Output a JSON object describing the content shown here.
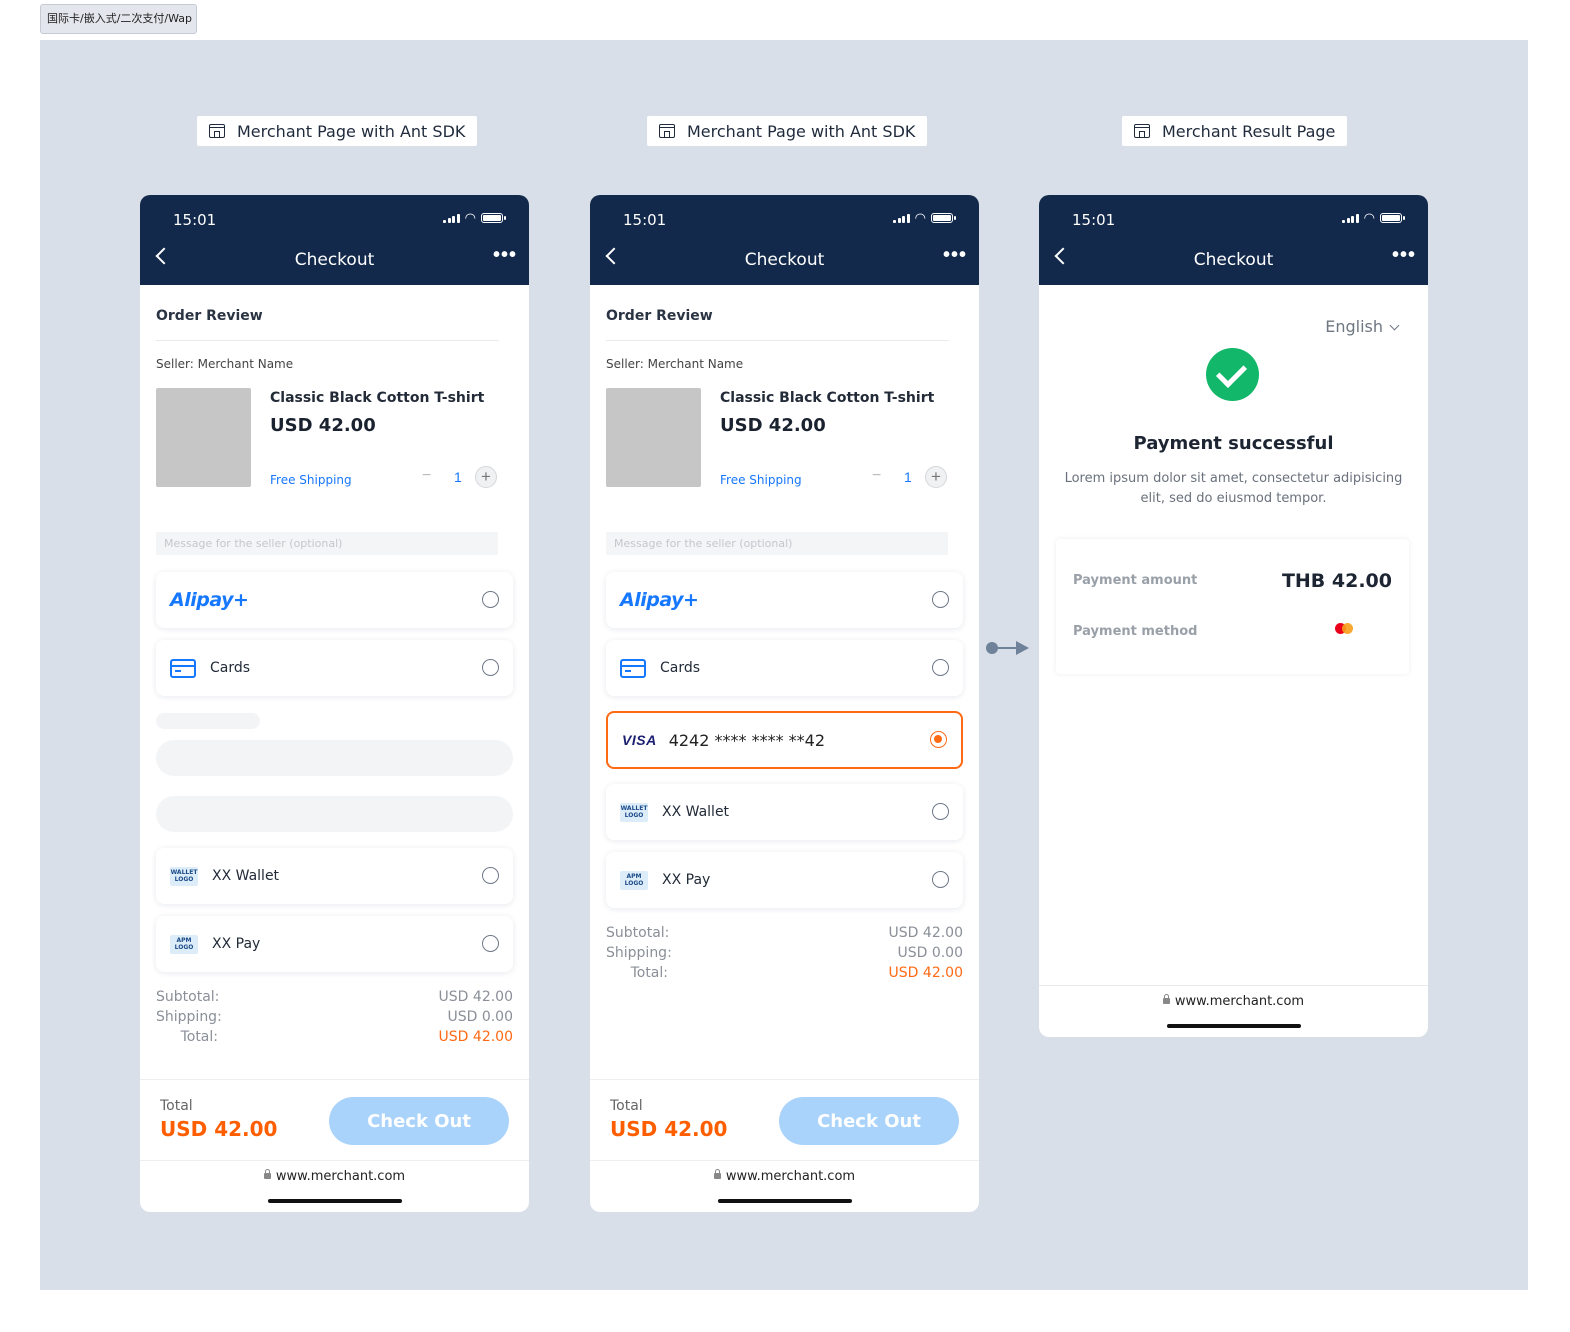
{
  "frame_tag": "国际卡/嵌入式/二次支付/Wap",
  "pages": [
    {
      "label": "Merchant Page with Ant SDK"
    },
    {
      "label": "Merchant Page with Ant SDK"
    },
    {
      "label": "Merchant Result Page"
    }
  ],
  "status": {
    "time": "15:01"
  },
  "nav": {
    "title": "Checkout",
    "more": "•••"
  },
  "order": {
    "title": "Order Review",
    "seller": "Seller: Merchant Name",
    "product_name": "Classic Black Cotton T-shirt",
    "product_price": "USD 42.00",
    "shipping": "Free Shipping",
    "qty_minus": "−",
    "qty": "1",
    "qty_plus": "+",
    "message_placeholder": "Message for the seller (optional)"
  },
  "payment_methods": {
    "alipay": "Alipay+",
    "cards": "Cards",
    "saved_card_brand": "VISA",
    "saved_card_number": "4242 **** **** **42",
    "wallet": "XX Wallet",
    "wallet_logo": "WALLET LOGO",
    "pay": "XX Pay",
    "pay_logo": "APM LOGO"
  },
  "summary": {
    "subtotal_label": "Subtotal:",
    "subtotal_value": "USD 42.00",
    "shipping_label": "Shipping:",
    "shipping_value": "USD 0.00",
    "total_label": "Total:",
    "total_value": "USD 42.00"
  },
  "footer": {
    "total_caption": "Total",
    "total_amount": "USD 42.00",
    "checkout_label": "Check Out",
    "url": "www.merchant.com"
  },
  "result": {
    "language": "English",
    "title": "Payment successful",
    "description": "Lorem ipsum dolor sit amet, consectetur adipisicing elit, sed do eiusmod tempor.",
    "amount_label": "Payment amount",
    "amount_value": "THB 42.00",
    "method_label": "Payment method",
    "method_icon": "mastercard-icon"
  },
  "colors": {
    "header_bg": "#13294b",
    "accent_blue": "#1677ff",
    "accent_orange": "#ff6a14",
    "success": "#12b76a",
    "button_disabled": "#a9d3fb",
    "canvas": "#d8dfe8"
  }
}
